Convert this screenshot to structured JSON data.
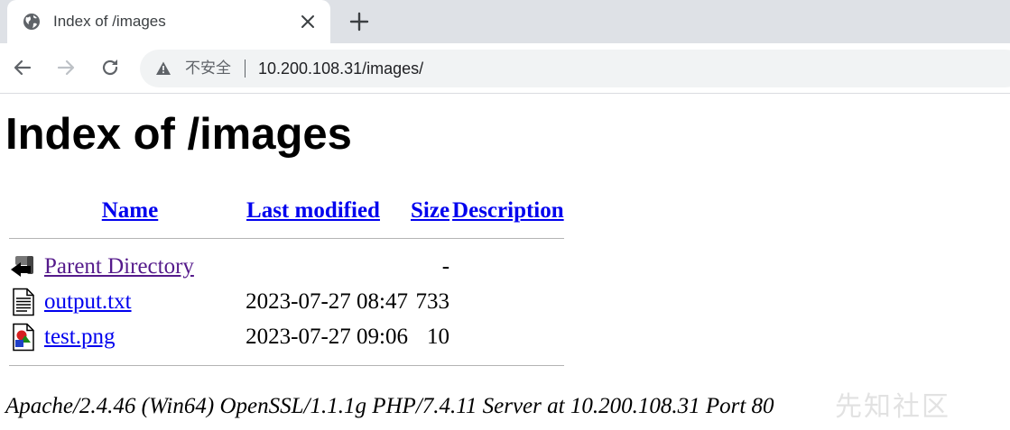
{
  "browser": {
    "tab_title": "Index of /images",
    "security_label": "不安全",
    "url": "10.200.108.31/images/"
  },
  "page": {
    "title": "Index of /images",
    "columns": {
      "name": "Name",
      "last_modified": "Last modified",
      "size": "Size",
      "description": "Description"
    },
    "rows": [
      {
        "icon": "back-icon",
        "name": "Parent Directory",
        "modified": "",
        "size": "-",
        "description": "",
        "visited": true
      },
      {
        "icon": "text-file-icon",
        "name": "output.txt",
        "modified": "2023-07-27 08:47",
        "size": "733",
        "description": "",
        "visited": false
      },
      {
        "icon": "image-file-icon",
        "name": "test.png",
        "modified": "2023-07-27 09:06",
        "size": "10",
        "description": "",
        "visited": false
      }
    ],
    "footer": "Apache/2.4.46 (Win64) OpenSSL/1.1.1g PHP/7.4.11 Server at 10.200.108.31 Port 80"
  },
  "watermark": "先知社区",
  "colors": {
    "link": "#0000ee",
    "visited_link": "#551a8b",
    "tab_strip": "#dee1e6",
    "omnibox": "#f1f3f4"
  }
}
